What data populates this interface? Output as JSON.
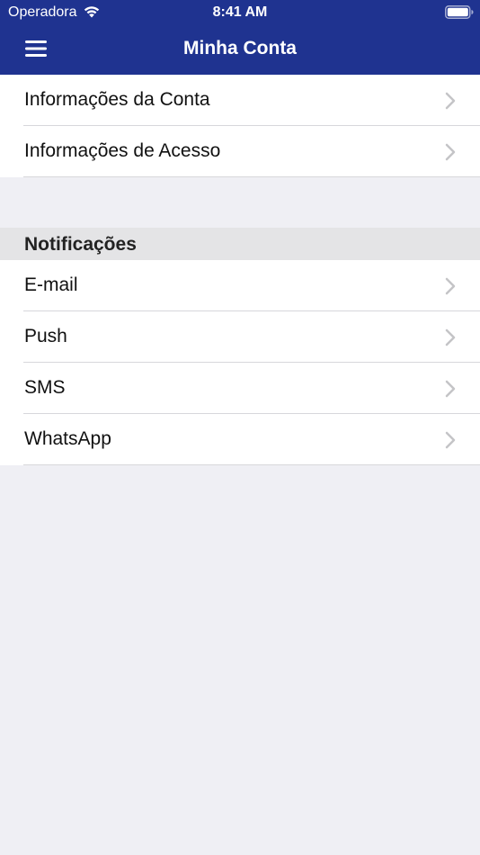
{
  "status_bar": {
    "carrier": "Operadora",
    "time": "8:41 AM",
    "icons": [
      "wifi-icon",
      "battery-icon"
    ]
  },
  "nav": {
    "title": "Minha Conta",
    "menu_icon": "hamburger-menu-icon"
  },
  "account_section": {
    "items": [
      {
        "label": "Informações da Conta"
      },
      {
        "label": "Informações de Acesso"
      }
    ]
  },
  "notifications_section": {
    "title": "Notificações",
    "items": [
      {
        "label": "E-mail"
      },
      {
        "label": "Push"
      },
      {
        "label": "SMS"
      },
      {
        "label": "WhatsApp"
      }
    ]
  },
  "colors": {
    "nav_background": "#1f3390",
    "page_background": "#efeff4",
    "section_header_background": "#e4e4e6",
    "chevron": "#c4c4c7"
  }
}
